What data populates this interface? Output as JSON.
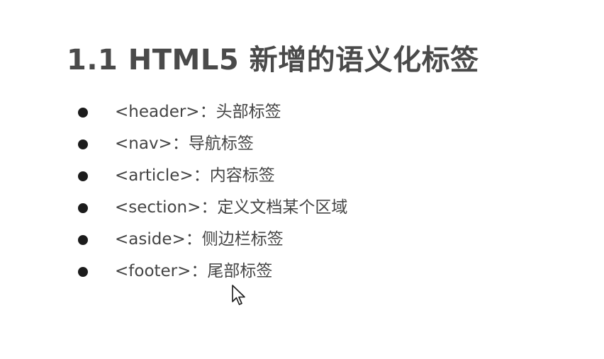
{
  "slide": {
    "title": "1.1 HTML5 新增的语义化标签",
    "items": [
      {
        "text": "<header>：头部标签"
      },
      {
        "text": "<nav>：导航标签"
      },
      {
        "text": "<article>：内容标签"
      },
      {
        "text": "<section>：定义文档某个区域"
      },
      {
        "text": "<aside>：侧边栏标签"
      },
      {
        "text": "<footer>：尾部标签"
      }
    ]
  },
  "icons": {
    "bullet": "filled-circle-bullet-icon",
    "pointer": "mouse-pointer-icon"
  },
  "colors": {
    "title": "#4a4a4a",
    "text": "#444444",
    "bullet": "#1c1c1c",
    "background": "#ffffff"
  }
}
